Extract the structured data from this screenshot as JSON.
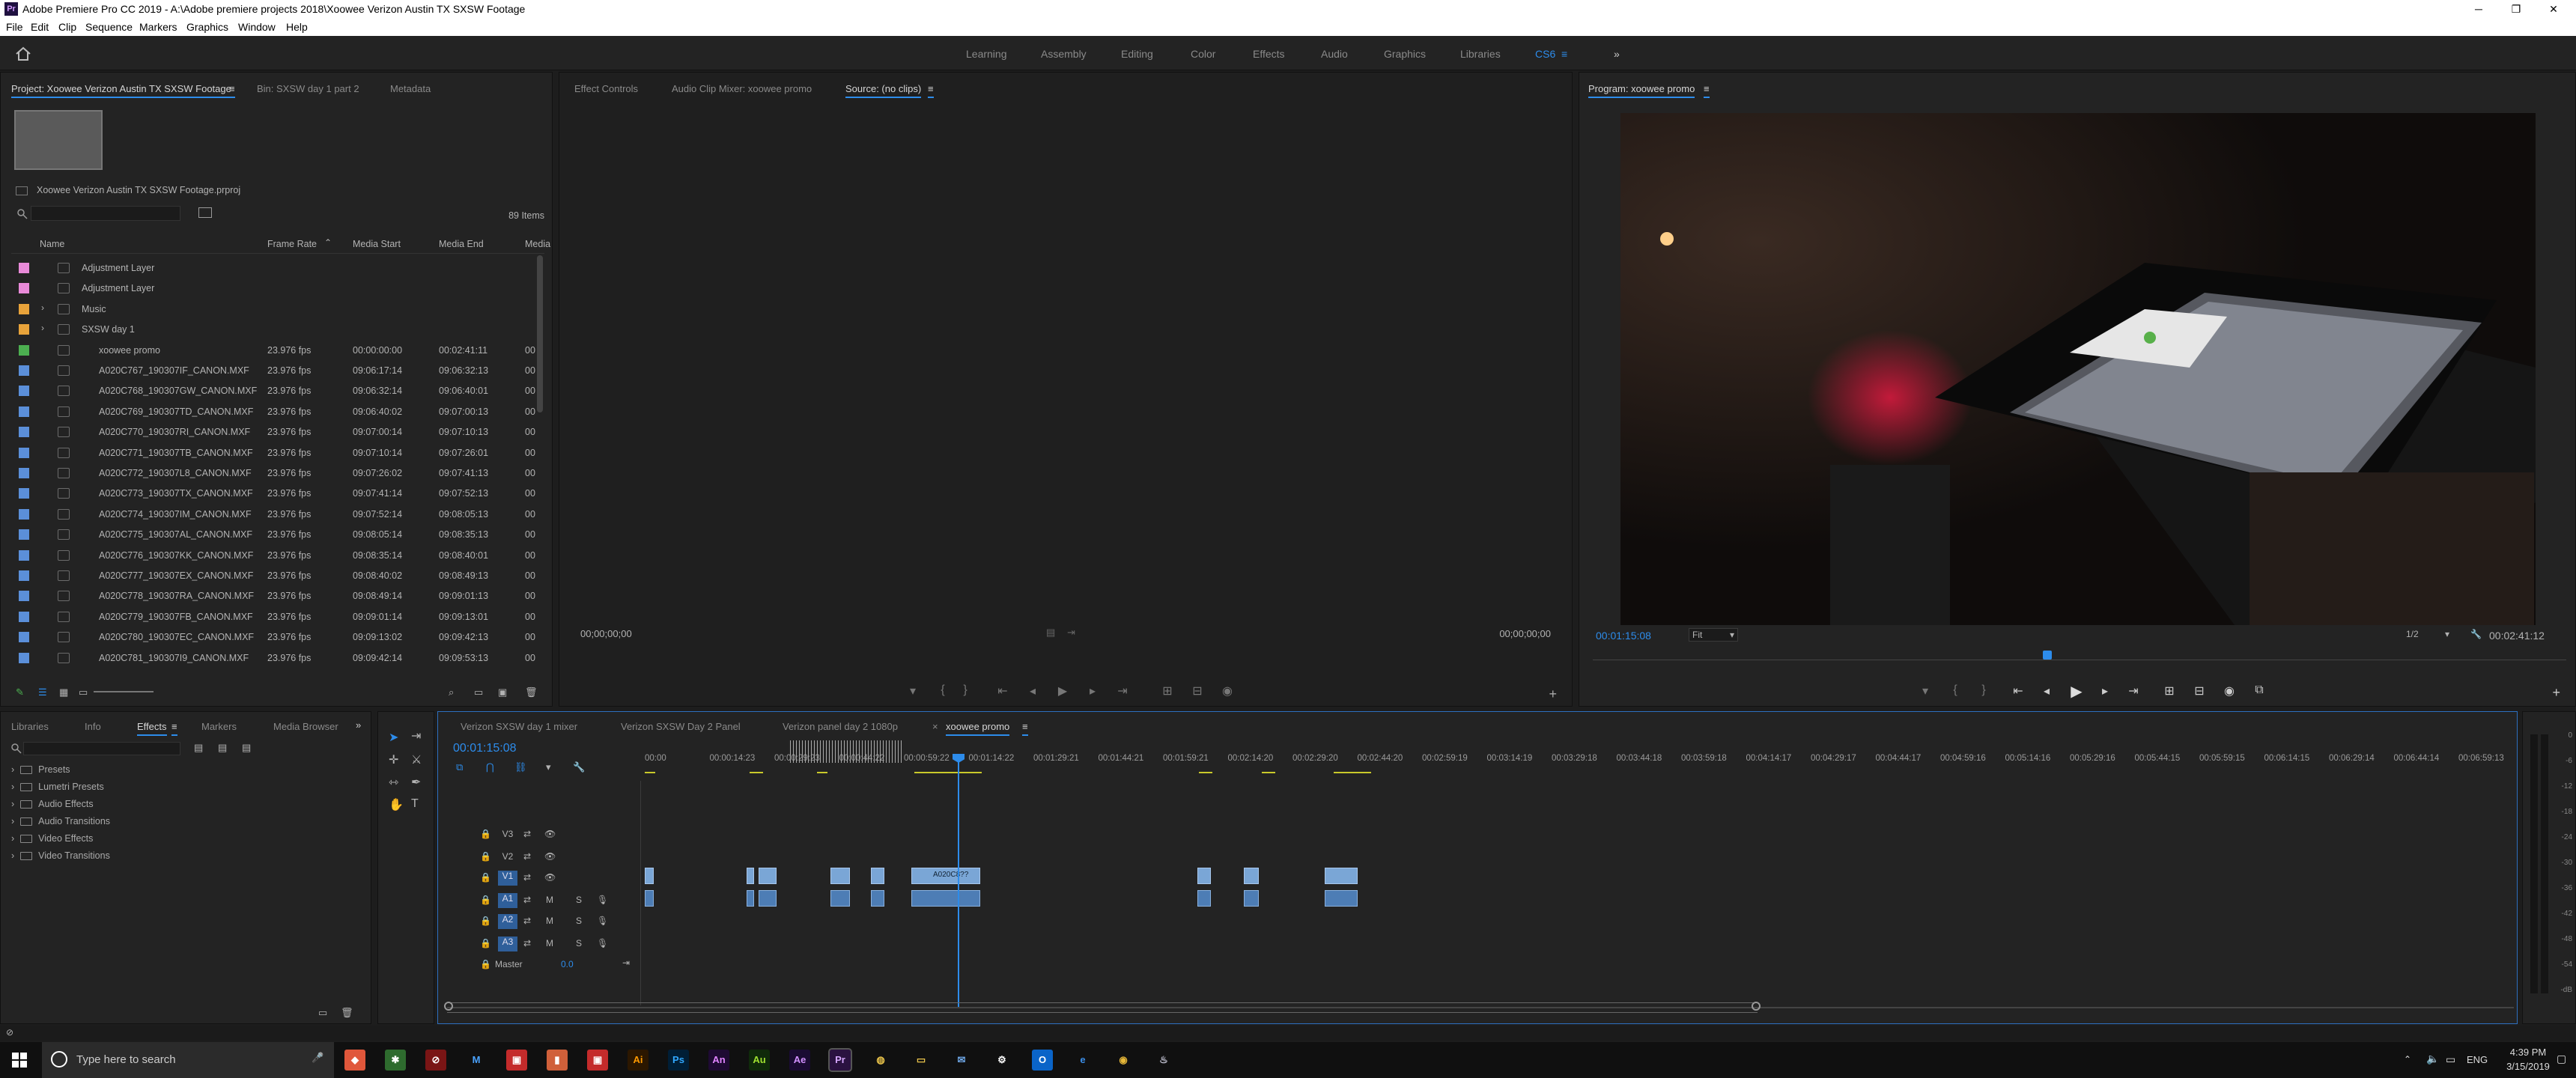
{
  "window": {
    "title": "Adobe Premiere Pro CC 2019 - A:\\Adobe premiere projects 2018\\Xoowee Verizon Austin TX SXSW Footage",
    "minimize": "─",
    "restore": "❐",
    "close": "✕",
    "app_badge": "Pr"
  },
  "menu": [
    "File",
    "Edit",
    "Clip",
    "Sequence",
    "Markers",
    "Graphics",
    "Window",
    "Help"
  ],
  "workspaces": [
    "Learning",
    "Assembly",
    "Editing",
    "Color",
    "Effects",
    "Audio",
    "Graphics",
    "Libraries",
    "CS6"
  ],
  "workspace_menu_icon": "≡",
  "workspace_more": "»",
  "project": {
    "tabs": [
      "Project: Xoowee Verizon Austin TX SXSW Footage",
      "Bin: SXSW day 1 part 2",
      "Metadata"
    ],
    "tab_menu": "≡",
    "file": "Xoowee Verizon Austin TX SXSW Footage.prproj",
    "items_count": "89 Items",
    "search_placeholder": "",
    "columns": [
      "Name",
      "Frame Rate",
      "Media Start",
      "Media End",
      "Media"
    ],
    "rows": [
      {
        "name": "Adjustment Layer",
        "rate": "",
        "start": "",
        "end": "",
        "more": "",
        "color": "#e88ad8",
        "indent": false
      },
      {
        "name": "Adjustment Layer",
        "rate": "",
        "start": "",
        "end": "",
        "more": "",
        "color": "#e88ad8",
        "indent": false
      },
      {
        "name": "Music",
        "rate": "",
        "start": "",
        "end": "",
        "more": "",
        "color": "#e8a33a",
        "indent": false
      },
      {
        "name": "SXSW day 1",
        "rate": "",
        "start": "",
        "end": "",
        "more": "",
        "color": "#e8a33a",
        "indent": false
      },
      {
        "name": "xoowee promo",
        "rate": "23.976 fps",
        "start": "00:00:00:00",
        "end": "00:02:41:11",
        "more": "00",
        "color": "#4caf50",
        "indent": true
      },
      {
        "name": "A020C767_190307IF_CANON.MXF",
        "rate": "23.976 fps",
        "start": "09:06:17:14",
        "end": "09:06:32:13",
        "more": "00",
        "color": "#5b8fd9",
        "indent": true
      },
      {
        "name": "A020C768_190307GW_CANON.MXF",
        "rate": "23.976 fps",
        "start": "09:06:32:14",
        "end": "09:06:40:01",
        "more": "00",
        "color": "#5b8fd9",
        "indent": true
      },
      {
        "name": "A020C769_190307TD_CANON.MXF",
        "rate": "23.976 fps",
        "start": "09:06:40:02",
        "end": "09:07:00:13",
        "more": "00",
        "color": "#5b8fd9",
        "indent": true
      },
      {
        "name": "A020C770_190307RI_CANON.MXF",
        "rate": "23.976 fps",
        "start": "09:07:00:14",
        "end": "09:07:10:13",
        "more": "00",
        "color": "#5b8fd9",
        "indent": true
      },
      {
        "name": "A020C771_190307TB_CANON.MXF",
        "rate": "23.976 fps",
        "start": "09:07:10:14",
        "end": "09:07:26:01",
        "more": "00",
        "color": "#5b8fd9",
        "indent": true
      },
      {
        "name": "A020C772_190307L8_CANON.MXF",
        "rate": "23.976 fps",
        "start": "09:07:26:02",
        "end": "09:07:41:13",
        "more": "00",
        "color": "#5b8fd9",
        "indent": true
      },
      {
        "name": "A020C773_190307TX_CANON.MXF",
        "rate": "23.976 fps",
        "start": "09:07:41:14",
        "end": "09:07:52:13",
        "more": "00",
        "color": "#5b8fd9",
        "indent": true
      },
      {
        "name": "A020C774_190307IM_CANON.MXF",
        "rate": "23.976 fps",
        "start": "09:07:52:14",
        "end": "09:08:05:13",
        "more": "00",
        "color": "#5b8fd9",
        "indent": true
      },
      {
        "name": "A020C775_190307AL_CANON.MXF",
        "rate": "23.976 fps",
        "start": "09:08:05:14",
        "end": "09:08:35:13",
        "more": "00",
        "color": "#5b8fd9",
        "indent": true
      },
      {
        "name": "A020C776_190307KK_CANON.MXF",
        "rate": "23.976 fps",
        "start": "09:08:35:14",
        "end": "09:08:40:01",
        "more": "00",
        "color": "#5b8fd9",
        "indent": true
      },
      {
        "name": "A020C777_190307EX_CANON.MXF",
        "rate": "23.976 fps",
        "start": "09:08:40:02",
        "end": "09:08:49:13",
        "more": "00",
        "color": "#5b8fd9",
        "indent": true
      },
      {
        "name": "A020C778_190307RA_CANON.MXF",
        "rate": "23.976 fps",
        "start": "09:08:49:14",
        "end": "09:09:01:13",
        "more": "00",
        "color": "#5b8fd9",
        "indent": true
      },
      {
        "name": "A020C779_190307FB_CANON.MXF",
        "rate": "23.976 fps",
        "start": "09:09:01:14",
        "end": "09:09:13:01",
        "more": "00",
        "color": "#5b8fd9",
        "indent": true
      },
      {
        "name": "A020C780_190307EC_CANON.MXF",
        "rate": "23.976 fps",
        "start": "09:09:13:02",
        "end": "09:09:42:13",
        "more": "00",
        "color": "#5b8fd9",
        "indent": true
      },
      {
        "name": "A020C781_190307I9_CANON.MXF",
        "rate": "23.976 fps",
        "start": "09:09:42:14",
        "end": "09:09:53:13",
        "more": "00",
        "color": "#5b8fd9",
        "indent": true
      }
    ]
  },
  "source": {
    "tabs": [
      "Effect Controls",
      "Audio Clip Mixer: xoowee promo",
      "Source: (no clips)"
    ],
    "tab_menu": "≡",
    "tc_left": "00;00;00;00",
    "tc_right": "00;00;00;00"
  },
  "program": {
    "title": "Program: xoowee promo",
    "tab_menu": "≡",
    "timecode": "00:01:15:08",
    "fit": "Fit",
    "resolution": "1/2",
    "duration": "00:02:41:12",
    "wrench": "🔧",
    "add": "+",
    "playhead_fraction": 0.467
  },
  "effects": {
    "tabs": [
      "Libraries",
      "Info",
      "Effects",
      "Markers",
      "Media Browser"
    ],
    "tab_menu": "≡",
    "more": "»",
    "items": [
      "Presets",
      "Lumetri Presets",
      "Audio Effects",
      "Audio Transitions",
      "Video Effects",
      "Video Transitions"
    ]
  },
  "timeline": {
    "tabs": [
      "Verizon SXSW day 1 mixer",
      "Verizon SXSW Day 2 Panel",
      "Verizon panel day 2 1080p",
      "xoowee promo"
    ],
    "close": "×",
    "tab_menu": "≡",
    "timecode": "00:01:15:08",
    "ruler": [
      "00:00",
      "00:00:14:23",
      "00:00:29:23",
      "00:00:44:22",
      "00:00:59:22",
      "00:01:14:22",
      "00:01:29:21",
      "00:01:44:21",
      "00:01:59:21",
      "00:02:14:20",
      "00:02:29:20",
      "00:02:44:20",
      "00:02:59:19",
      "00:03:14:19",
      "00:03:29:18",
      "00:03:44:18",
      "00:03:59:18",
      "00:04:14:17",
      "00:04:29:17",
      "00:04:44:17",
      "00:04:59:16",
      "00:05:14:16",
      "00:05:29:16",
      "00:05:44:15",
      "00:05:59:15",
      "00:06:14:15",
      "00:06:29:14",
      "00:06:44:14",
      "00:06:59:13"
    ],
    "video_tracks": [
      "V3",
      "V2",
      "V1"
    ],
    "audio_tracks": [
      "A1",
      "A2",
      "A3"
    ],
    "master": "Master",
    "master_val": "0.0",
    "clip_label": "A020C8??",
    "lock": "🔒",
    "sync": "⇄",
    "eye": "👁",
    "mute": "M",
    "solo": "S",
    "mic": "🎙",
    "end_marker": "⇥"
  },
  "meter": {
    "labels": [
      "0",
      "-6",
      "-12",
      "-18",
      "-24",
      "-30",
      "-36",
      "-42",
      "-48",
      "-54",
      "-dB"
    ]
  },
  "taskbar": {
    "search": "Type here to search",
    "time": "4:39 PM",
    "date": "3/15/2019",
    "lang": "ENG",
    "apps": [
      {
        "label": "Ai",
        "fg": "#ff9a00",
        "bg": "#2b1700"
      },
      {
        "label": "Ps",
        "fg": "#31a8ff",
        "bg": "#001e36"
      },
      {
        "label": "An",
        "fg": "#e084ff",
        "bg": "#1e0a33"
      },
      {
        "label": "Au",
        "fg": "#9fe030",
        "bg": "#0f2a0a"
      },
      {
        "label": "Ae",
        "fg": "#d291ff",
        "bg": "#1a0b33"
      },
      {
        "label": "Pr",
        "fg": "#d7a8ff",
        "bg": "#2a1240"
      }
    ]
  }
}
